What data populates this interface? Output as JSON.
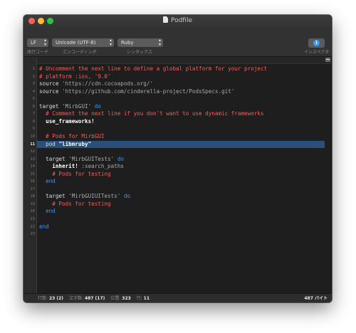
{
  "window": {
    "title": "Podfile"
  },
  "toolbar": {
    "line_ending": {
      "value": "LF",
      "label": "改行コード"
    },
    "encoding": {
      "value": "Unicode (UTF-8)",
      "label": "エンコーディング"
    },
    "syntax": {
      "value": "Ruby",
      "label": "シンタックス"
    },
    "inspector": {
      "label": "インスペクタ",
      "icon": "info-icon"
    }
  },
  "editor": {
    "current_line": 11,
    "lines": [
      {
        "n": "1",
        "tokens": [
          {
            "t": "# Uncomment the next line to define a global platform for your project",
            "c": "comment"
          }
        ]
      },
      {
        "n": "2",
        "tokens": [
          {
            "t": "# platform :ios, '9.0'",
            "c": "comment"
          }
        ]
      },
      {
        "n": "3",
        "tokens": [
          {
            "t": "source ",
            "c": "plain"
          },
          {
            "t": "'https://cdn.cocoapods.org/'",
            "c": "str"
          }
        ]
      },
      {
        "n": "4",
        "tokens": [
          {
            "t": "source ",
            "c": "plain"
          },
          {
            "t": "'https://github.com/cinderella-project/PodsSpecs.git'",
            "c": "str"
          }
        ]
      },
      {
        "n": "5",
        "tokens": []
      },
      {
        "n": "6",
        "tokens": [
          {
            "t": "target ",
            "c": "plain"
          },
          {
            "t": "'MirbGUI'",
            "c": "str"
          },
          {
            "t": " do",
            "c": "kw"
          }
        ]
      },
      {
        "n": "7",
        "tokens": [
          {
            "t": "  # Comment the next line if you don't want to use dynamic frameworks",
            "c": "comment"
          }
        ]
      },
      {
        "n": "8",
        "tokens": [
          {
            "t": "  use_frameworks!",
            "c": "method"
          }
        ]
      },
      {
        "n": "9",
        "tokens": []
      },
      {
        "n": "10",
        "tokens": [
          {
            "t": "  # Pods for MirbGUI",
            "c": "comment"
          }
        ]
      },
      {
        "n": "11",
        "tokens": [
          {
            "t": "  pod ",
            "c": "plain"
          },
          {
            "t": "\"libmruby\"",
            "c": "hlstr"
          }
        ]
      },
      {
        "n": "12",
        "tokens": []
      },
      {
        "n": "13",
        "tokens": [
          {
            "t": "  target ",
            "c": "plain"
          },
          {
            "t": "'MirbGUITests'",
            "c": "str"
          },
          {
            "t": " do",
            "c": "kw"
          }
        ]
      },
      {
        "n": "14",
        "tokens": [
          {
            "t": "    inherit! ",
            "c": "method"
          },
          {
            "t": ":search_paths",
            "c": "sym"
          }
        ]
      },
      {
        "n": "15",
        "tokens": [
          {
            "t": "    # Pods for testing",
            "c": "comment"
          }
        ]
      },
      {
        "n": "16",
        "tokens": [
          {
            "t": "  end",
            "c": "kw"
          }
        ]
      },
      {
        "n": "17",
        "tokens": []
      },
      {
        "n": "18",
        "tokens": [
          {
            "t": "  target ",
            "c": "plain"
          },
          {
            "t": "'MirbGUIUITests'",
            "c": "str"
          },
          {
            "t": " do",
            "c": "kw"
          }
        ]
      },
      {
        "n": "19",
        "tokens": [
          {
            "t": "    # Pods for testing",
            "c": "comment"
          }
        ]
      },
      {
        "n": "20",
        "tokens": [
          {
            "t": "  end",
            "c": "kw"
          }
        ]
      },
      {
        "n": "21",
        "tokens": []
      },
      {
        "n": "22",
        "tokens": [
          {
            "t": "end",
            "c": "kw"
          }
        ]
      },
      {
        "n": "23",
        "tokens": []
      }
    ]
  },
  "status": {
    "lines_label": "行数:",
    "lines_value": "23 (2)",
    "chars_label": "文字数:",
    "chars_value": "487 (17)",
    "position_label": "位置:",
    "position_value": "323",
    "row_label": "行:",
    "row_value": "11",
    "bytes": "487 バイト"
  },
  "colors": {
    "comment": "#fd5a55",
    "keyword": "#3b95f2",
    "string": "#a9a9a9",
    "selection": "#2b4f7c",
    "background": "#1e1e1e"
  }
}
